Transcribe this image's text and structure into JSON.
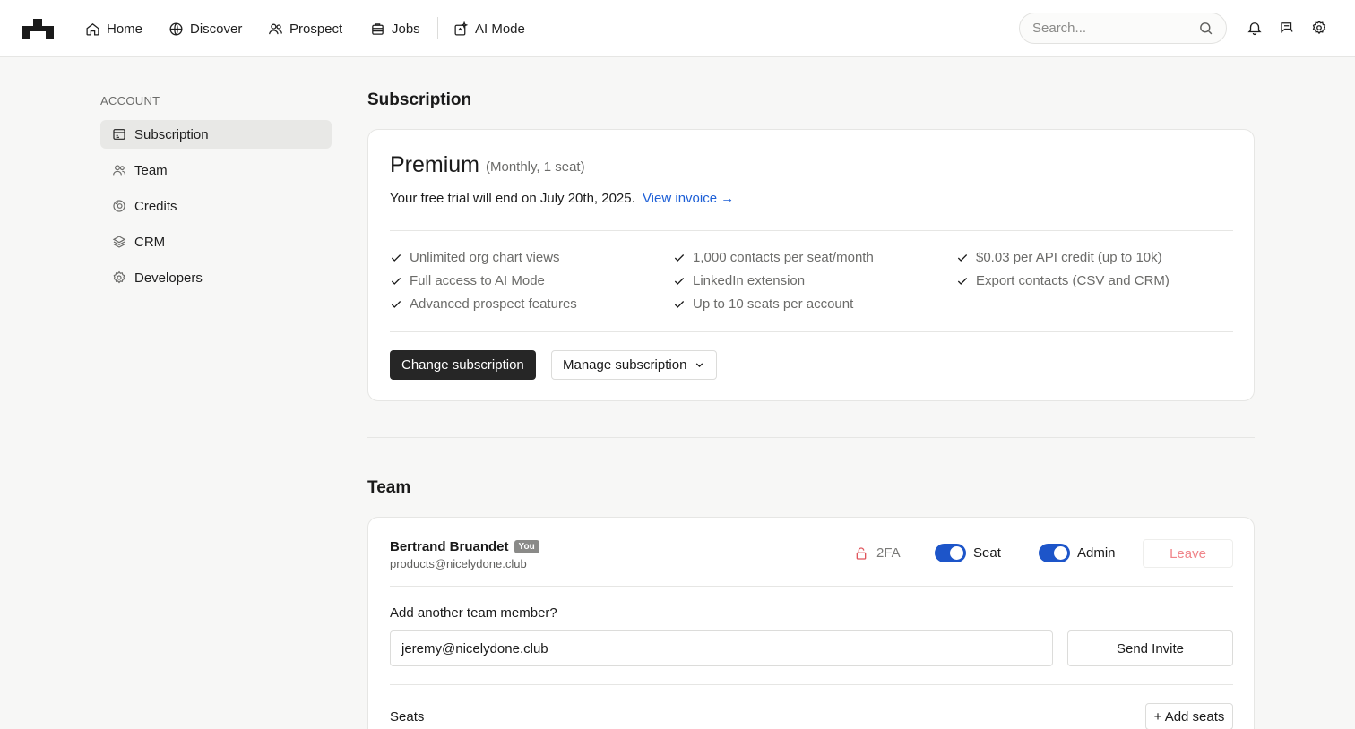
{
  "nav": {
    "items": [
      {
        "label": "Home",
        "icon": "home-icon"
      },
      {
        "label": "Discover",
        "icon": "globe-icon"
      },
      {
        "label": "Prospect",
        "icon": "users-icon"
      },
      {
        "label": "Jobs",
        "icon": "briefcase-icon"
      },
      {
        "label": "AI Mode",
        "icon": "ai-sparkle-icon"
      }
    ],
    "search_placeholder": "Search...",
    "right_icons": [
      "bell-icon",
      "message-icon",
      "gear-icon"
    ]
  },
  "sidebar": {
    "heading": "ACCOUNT",
    "items": [
      {
        "label": "Subscription",
        "icon": "card-icon",
        "active": true
      },
      {
        "label": "Team",
        "icon": "users-icon",
        "active": false
      },
      {
        "label": "Credits",
        "icon": "coins-icon",
        "active": false
      },
      {
        "label": "CRM",
        "icon": "layers-icon",
        "active": false
      },
      {
        "label": "Developers",
        "icon": "gear-icon",
        "active": false
      }
    ]
  },
  "subscription": {
    "title": "Subscription",
    "plan_name": "Premium",
    "plan_meta": "(Monthly, 1 seat)",
    "trial_text": "Your free trial will end on July 20th, 2025.",
    "invoice_link": "View invoice →",
    "features": [
      "Unlimited org chart views",
      "Full access to AI Mode",
      "Advanced prospect features",
      "1,000 contacts per seat/month",
      "LinkedIn extension",
      "Up to 10 seats per account",
      "$0.03 per API credit (up to 10k)",
      "Export contacts (CSV and CRM)"
    ],
    "change_button": "Change subscription",
    "manage_button": "Manage subscription"
  },
  "team": {
    "title": "Team",
    "member": {
      "name": "Bertrand Bruandet",
      "badge": "You",
      "email": "products@nicelydone.club",
      "twofa_label": "2FA",
      "seat_label": "Seat",
      "seat_on": true,
      "admin_label": "Admin",
      "admin_on": true,
      "leave_button": "Leave"
    },
    "add_label": "Add another team member?",
    "invite_email": "jeremy@nicelydone.club",
    "invite_button": "Send Invite",
    "seats_label": "Seats",
    "add_seats_button": "+ Add seats"
  },
  "colors": {
    "accent": "#1d55c9",
    "link": "#1d5fd6",
    "leave": "#f0858a",
    "lock": "#e0555c"
  }
}
